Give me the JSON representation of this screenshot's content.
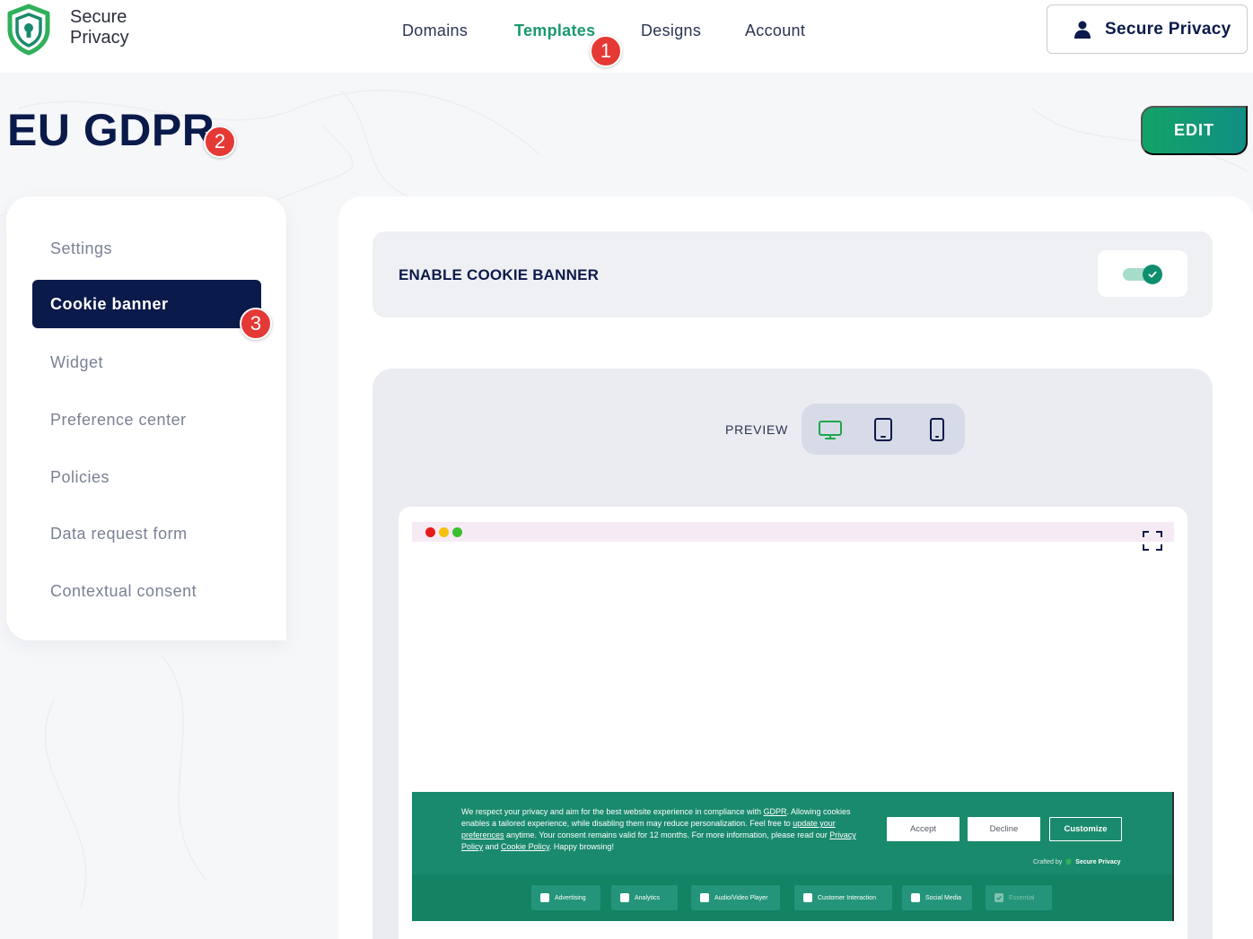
{
  "brand": {
    "line1": "Secure",
    "line2": "Privacy"
  },
  "nav": {
    "items": [
      {
        "label": "Domains"
      },
      {
        "label": "Templates"
      },
      {
        "label": "Designs"
      },
      {
        "label": "Account"
      }
    ],
    "active_index": 1
  },
  "account": {
    "label": "Secure Privacy",
    "icon": "user-icon"
  },
  "page": {
    "title": "EU GDPR",
    "edit_label": "EDIT"
  },
  "badges": [
    "1",
    "2",
    "3"
  ],
  "sidebar": {
    "items": [
      {
        "label": "Settings"
      },
      {
        "label": "Cookie banner"
      },
      {
        "label": "Widget"
      },
      {
        "label": "Preference center"
      },
      {
        "label": "Policies"
      },
      {
        "label": "Data request form"
      },
      {
        "label": "Contextual consent"
      }
    ],
    "active_index": 1
  },
  "toggle": {
    "label": "ENABLE COOKIE BANNER",
    "enabled": true
  },
  "preview": {
    "label": "PREVIEW",
    "devices": [
      "desktop-icon",
      "tablet-icon",
      "mobile-icon"
    ],
    "selected": "desktop"
  },
  "banner": {
    "text_1": "We respect your privacy and aim for the best website experience in compliance with ",
    "gdpr": "GDPR",
    "text_2": ". Allowing cookies enables a tailored experience, while disabling them may reduce personalization. Feel free to ",
    "update": "update your preferences",
    "text_3": " anytime. Your consent remains valid for 12 months. For more information, please read our ",
    "privacy": "Privacy Policy",
    "and": " and ",
    "cookie": "Cookie Policy",
    "text_4": ". Happy browsing!",
    "accept": "Accept",
    "decline": "Decline",
    "customize": "Customize",
    "crafted_by": "Crafted by",
    "crafted_brand": "Secure Privacy",
    "categories": [
      {
        "label": "Advertising",
        "checked": false
      },
      {
        "label": "Analytics",
        "checked": false
      },
      {
        "label": "Audio/Video Player",
        "checked": false
      },
      {
        "label": "Customer Interaction",
        "checked": false
      },
      {
        "label": "Social Media",
        "checked": false
      },
      {
        "label": "Essential",
        "checked": true,
        "disabled": true
      }
    ]
  },
  "colors": {
    "navy": "#0a1a4a",
    "green": "#1a9a6c",
    "banner": "#1a8a6c",
    "badge": "#e53935"
  }
}
